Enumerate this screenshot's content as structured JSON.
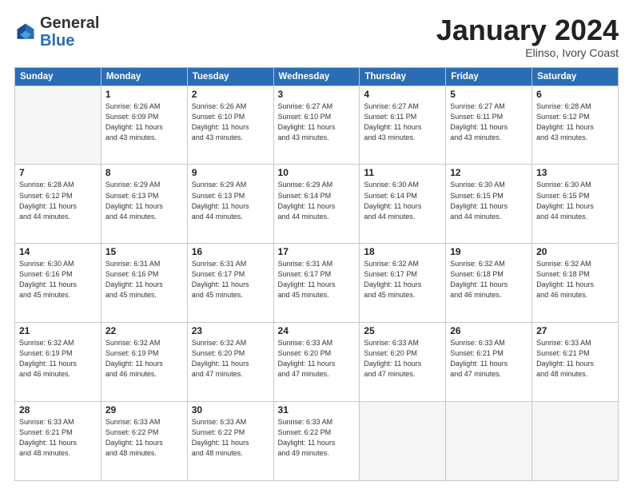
{
  "logo": {
    "general": "General",
    "blue": "Blue"
  },
  "header": {
    "month": "January 2024",
    "location": "Elinso, Ivory Coast"
  },
  "weekdays": [
    "Sunday",
    "Monday",
    "Tuesday",
    "Wednesday",
    "Thursday",
    "Friday",
    "Saturday"
  ],
  "weeks": [
    [
      {
        "day": "",
        "info": ""
      },
      {
        "day": "1",
        "info": "Sunrise: 6:26 AM\nSunset: 6:09 PM\nDaylight: 11 hours\nand 43 minutes."
      },
      {
        "day": "2",
        "info": "Sunrise: 6:26 AM\nSunset: 6:10 PM\nDaylight: 11 hours\nand 43 minutes."
      },
      {
        "day": "3",
        "info": "Sunrise: 6:27 AM\nSunset: 6:10 PM\nDaylight: 11 hours\nand 43 minutes."
      },
      {
        "day": "4",
        "info": "Sunrise: 6:27 AM\nSunset: 6:11 PM\nDaylight: 11 hours\nand 43 minutes."
      },
      {
        "day": "5",
        "info": "Sunrise: 6:27 AM\nSunset: 6:11 PM\nDaylight: 11 hours\nand 43 minutes."
      },
      {
        "day": "6",
        "info": "Sunrise: 6:28 AM\nSunset: 6:12 PM\nDaylight: 11 hours\nand 43 minutes."
      }
    ],
    [
      {
        "day": "7",
        "info": "Sunrise: 6:28 AM\nSunset: 6:12 PM\nDaylight: 11 hours\nand 44 minutes."
      },
      {
        "day": "8",
        "info": "Sunrise: 6:29 AM\nSunset: 6:13 PM\nDaylight: 11 hours\nand 44 minutes."
      },
      {
        "day": "9",
        "info": "Sunrise: 6:29 AM\nSunset: 6:13 PM\nDaylight: 11 hours\nand 44 minutes."
      },
      {
        "day": "10",
        "info": "Sunrise: 6:29 AM\nSunset: 6:14 PM\nDaylight: 11 hours\nand 44 minutes."
      },
      {
        "day": "11",
        "info": "Sunrise: 6:30 AM\nSunset: 6:14 PM\nDaylight: 11 hours\nand 44 minutes."
      },
      {
        "day": "12",
        "info": "Sunrise: 6:30 AM\nSunset: 6:15 PM\nDaylight: 11 hours\nand 44 minutes."
      },
      {
        "day": "13",
        "info": "Sunrise: 6:30 AM\nSunset: 6:15 PM\nDaylight: 11 hours\nand 44 minutes."
      }
    ],
    [
      {
        "day": "14",
        "info": "Sunrise: 6:30 AM\nSunset: 6:16 PM\nDaylight: 11 hours\nand 45 minutes."
      },
      {
        "day": "15",
        "info": "Sunrise: 6:31 AM\nSunset: 6:16 PM\nDaylight: 11 hours\nand 45 minutes."
      },
      {
        "day": "16",
        "info": "Sunrise: 6:31 AM\nSunset: 6:17 PM\nDaylight: 11 hours\nand 45 minutes."
      },
      {
        "day": "17",
        "info": "Sunrise: 6:31 AM\nSunset: 6:17 PM\nDaylight: 11 hours\nand 45 minutes."
      },
      {
        "day": "18",
        "info": "Sunrise: 6:32 AM\nSunset: 6:17 PM\nDaylight: 11 hours\nand 45 minutes."
      },
      {
        "day": "19",
        "info": "Sunrise: 6:32 AM\nSunset: 6:18 PM\nDaylight: 11 hours\nand 46 minutes."
      },
      {
        "day": "20",
        "info": "Sunrise: 6:32 AM\nSunset: 6:18 PM\nDaylight: 11 hours\nand 46 minutes."
      }
    ],
    [
      {
        "day": "21",
        "info": "Sunrise: 6:32 AM\nSunset: 6:19 PM\nDaylight: 11 hours\nand 46 minutes."
      },
      {
        "day": "22",
        "info": "Sunrise: 6:32 AM\nSunset: 6:19 PM\nDaylight: 11 hours\nand 46 minutes."
      },
      {
        "day": "23",
        "info": "Sunrise: 6:32 AM\nSunset: 6:20 PM\nDaylight: 11 hours\nand 47 minutes."
      },
      {
        "day": "24",
        "info": "Sunrise: 6:33 AM\nSunset: 6:20 PM\nDaylight: 11 hours\nand 47 minutes."
      },
      {
        "day": "25",
        "info": "Sunrise: 6:33 AM\nSunset: 6:20 PM\nDaylight: 11 hours\nand 47 minutes."
      },
      {
        "day": "26",
        "info": "Sunrise: 6:33 AM\nSunset: 6:21 PM\nDaylight: 11 hours\nand 47 minutes."
      },
      {
        "day": "27",
        "info": "Sunrise: 6:33 AM\nSunset: 6:21 PM\nDaylight: 11 hours\nand 48 minutes."
      }
    ],
    [
      {
        "day": "28",
        "info": "Sunrise: 6:33 AM\nSunset: 6:21 PM\nDaylight: 11 hours\nand 48 minutes."
      },
      {
        "day": "29",
        "info": "Sunrise: 6:33 AM\nSunset: 6:22 PM\nDaylight: 11 hours\nand 48 minutes."
      },
      {
        "day": "30",
        "info": "Sunrise: 6:33 AM\nSunset: 6:22 PM\nDaylight: 11 hours\nand 48 minutes."
      },
      {
        "day": "31",
        "info": "Sunrise: 6:33 AM\nSunset: 6:22 PM\nDaylight: 11 hours\nand 49 minutes."
      },
      {
        "day": "",
        "info": ""
      },
      {
        "day": "",
        "info": ""
      },
      {
        "day": "",
        "info": ""
      }
    ]
  ]
}
